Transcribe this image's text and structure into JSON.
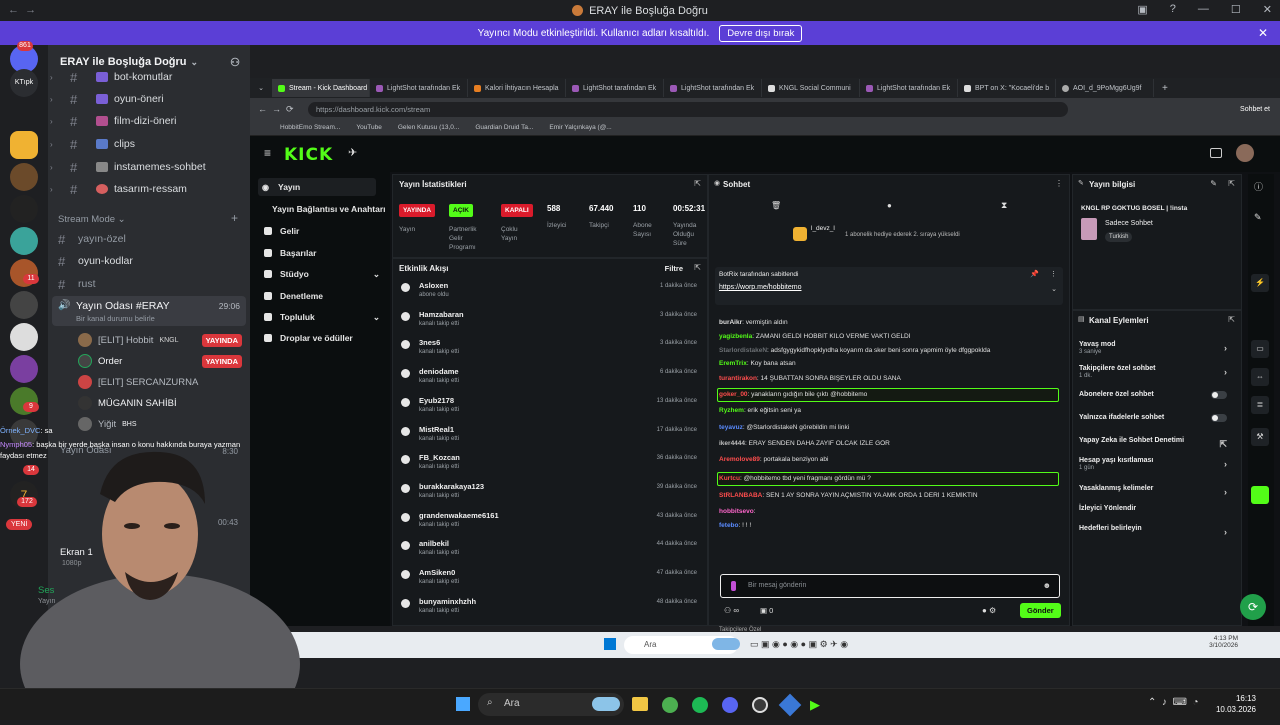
{
  "window": {
    "title": "ERAY ile Boşluğa Doğru"
  },
  "banner": {
    "text": "Yayıncı Modu etkinleştirildi. Kullanıcı adları kısaltıldı.",
    "button": "Devre dışı bırak"
  },
  "rail": {
    "badges": [
      "861",
      "11",
      "9",
      "14",
      "172"
    ],
    "new_label": "YENİ"
  },
  "server": {
    "name": "ERAY ile Boşluğa Doğru",
    "channels": [
      {
        "name": "bot-komutlar"
      },
      {
        "name": "oyun-öneri"
      },
      {
        "name": "film-dizi-öneri"
      },
      {
        "name": "clips"
      },
      {
        "name": "instamemes-sohbet"
      },
      {
        "name": "tasarım-ressam"
      }
    ],
    "category": "Stream Mode",
    "stream_channels": [
      {
        "name": "yayın-özel"
      },
      {
        "name": "oyun-kodlar"
      },
      {
        "name": "rust"
      }
    ],
    "voice": {
      "name": "Yayın Odası #ERAY",
      "time": "29:06",
      "status": "Bir kanal durumu belirle",
      "users": [
        {
          "name": "[ELIT] Hobbit",
          "tag": "KNGL",
          "live": "YAYINDA"
        },
        {
          "name": "Order",
          "live": "YAYINDA"
        },
        {
          "name": "[ELIT] SERCANZURNA"
        },
        {
          "name": "MÜGANIN SAHİBİ"
        },
        {
          "name": "Yiğit",
          "tag": "BHS"
        }
      ]
    },
    "voice2_name": "Yayın Odası",
    "voice2_time": "8:30",
    "voice3_time": "00:43"
  },
  "overlay_chat": [
    {
      "user": "Örnek_DVC",
      "text": ": sa"
    },
    {
      "user": "Nymph05",
      "text": ": başka bir yerde başka insan o konu hakkında buraya yazman"
    },
    {
      "user": "",
      "text": "faydası etmez"
    }
  ],
  "screenshare": {
    "name": "Ekran 1",
    "quality": "1080p",
    "audio": "Ses",
    "audio_sub": "Yayın"
  },
  "browser": {
    "tabs": [
      "Stream - Kick Dashboard",
      "LightShot tarafından Ek",
      "Kalori İhtiyacın Hesapla",
      "LightShot tarafından Ek",
      "LightShot tarafından Ek",
      "KNGL Social Communi",
      "LightShot tarafından Ek",
      "BPT on X: \"Kocaeli'de b",
      "AOI_d_9PoMgg6Ug9f"
    ],
    "url": "https://dashboard.kick.com/stream",
    "bookmarks": [
      "HobbitEmo Stream...",
      "YouTube",
      "Gelen Kutusu (13,0...",
      "Guardian Druid Ta...",
      "Emir Yalçınkaya (@..."
    ]
  },
  "kick": {
    "logo": "KICK",
    "nav": [
      "Yayın",
      "Yayın Bağlantısı ve Anahtarı",
      "Gelir",
      "Başarılar",
      "Stüdyo",
      "Denetleme",
      "Topluluk",
      "Droplar ve ödüller"
    ],
    "stats": {
      "title": "Yayın İstatistikleri",
      "badges": [
        "YAYINDA",
        "AÇIK",
        "KAPALI"
      ],
      "values": [
        "588",
        "67.440",
        "110",
        "00:52:31"
      ],
      "labels": [
        "Yayın",
        "Partnerlik Gelir Programı",
        "Çoklu Yayın",
        "İzleyici",
        "Takipçi",
        "Abone Sayısı",
        "Yayında Olduğu Süre"
      ]
    },
    "activity": {
      "title": "Etkinlik Akışı",
      "filter": "Filtre",
      "items": [
        {
          "name": "Asloxen",
          "sub": "abone oldu",
          "time": "1 dakika önce"
        },
        {
          "name": "Hamzabaran",
          "sub": "kanalı takip etti",
          "time": "3 dakika önce"
        },
        {
          "name": "3nes6",
          "sub": "kanalı takip etti",
          "time": "3 dakika önce"
        },
        {
          "name": "deniodame",
          "sub": "kanalı takip etti",
          "time": "6 dakika önce"
        },
        {
          "name": "Eyub2178",
          "sub": "kanalı takip etti",
          "time": "13 dakika önce"
        },
        {
          "name": "MistReal1",
          "sub": "kanalı takip etti",
          "time": "17 dakika önce"
        },
        {
          "name": "FB_Kozcan",
          "sub": "kanalı takip etti",
          "time": "36 dakika önce"
        },
        {
          "name": "burakkarakaya123",
          "sub": "kanalı takip etti",
          "time": "39 dakika önce"
        },
        {
          "name": "grandenwakaeme6161",
          "sub": "kanalı takip etti",
          "time": "43 dakika önce"
        },
        {
          "name": "anilbekil",
          "sub": "kanalı takip etti",
          "time": "44 dakika önce"
        },
        {
          "name": "AmSiken0",
          "sub": "kanalı takip etti",
          "time": "47 dakika önce"
        },
        {
          "name": "bunyaminxhzhh",
          "sub": "kanalı takip etti",
          "time": "48 dakika önce"
        }
      ]
    },
    "chat": {
      "title": "Sohbet",
      "gift_user": "l_devz_l",
      "gift_text": "1 abonelik hediye ederek 2. sıraya yükseldi",
      "pinned_by": "BotRix tarafından sabitlendi",
      "pinned_link": "https://worp.me/hobbitemo",
      "messages": [
        {
          "user": "burAikr",
          "text": ": vermiştin aldın",
          "color": "#e0e0e0"
        },
        {
          "user": "yagizbenla",
          "text": ": ZAMANI GELDİ HOBBİT KİLO VERME VAKTİ GELDİ",
          "color": "#53fc18"
        },
        {
          "user": "StarlordistakeN",
          "text": ": adsfgygykidfhopklyıdha koyarım da sker beni sonra yapmim öyle dfggpoklda",
          "color": "#6b6f73"
        },
        {
          "user": "EremTrix",
          "text": ": Koy bana atsan",
          "color": "#53fc18"
        },
        {
          "user": "turantirakon",
          "text": ": 14 ŞUBATTAN SONRA BİŞEYLER OLDU SANA",
          "color": "#ff4d4d"
        },
        {
          "user": "goker_00",
          "text": ": yanakların gıdığın bile çıktı @hobbitemo",
          "color": "#ff4d4d"
        },
        {
          "user": "Ryzhem",
          "text": ": erik eğitsin seni ya",
          "color": "#53fc18"
        },
        {
          "user": "teyavuz",
          "text": ": @StarlordistakeN görebildin mi linki",
          "color": "#5a8bff"
        },
        {
          "user": "iker4444",
          "text": ": ERAY SENDEN DAHA ZAYIF OLCAK İZLE GÖR",
          "color": "#c0c0c0"
        },
        {
          "user": "Aremolove89",
          "text": ": portakala benziyon abi",
          "color": "#ff4d4d"
        },
        {
          "user": "Kurtcu",
          "text": ": @hobbitemo tbd yeni fragmanı gördün mü ?",
          "color": "#ff4d4d"
        },
        {
          "user": "StRLANBABA",
          "text": ": SEN 1 AY SONRA YAYIN AÇMISTIN YA AMK ORDA 1 DERİ 1 KEMİKTİN",
          "color": "#ff4d4d"
        },
        {
          "user": "hobbitsevo",
          "text": ":",
          "color": "#ff66cc"
        },
        {
          "user": "fetebo",
          "text": ": ! ! !",
          "color": "#5a8bff"
        }
      ],
      "follower_only": "Takipçilere Özel",
      "input_placeholder": "Bir mesaj gönderin",
      "send": "Gönder",
      "count": "0"
    },
    "info": {
      "title": "Yayın bilgisi",
      "stream_title": "KNGL RP GOKTUG BOSEL | !insta",
      "category": "Sadece Sohbet",
      "language": "Turkish"
    },
    "actions": {
      "title": "Kanal Eylemleri",
      "items": [
        {
          "label": "Yavaş mod",
          "sub": "3 saniye",
          "ctrl": "chev"
        },
        {
          "label": "Takipçilere özel sohbet",
          "sub": "1 dk.",
          "ctrl": "chev"
        },
        {
          "label": "Abonelere özel sohbet",
          "sub": "",
          "ctrl": "toggle"
        },
        {
          "label": "Yalnızca ifadelerle sohbet",
          "sub": "",
          "ctrl": "toggle"
        },
        {
          "label": "Yapay Zeka ile Sohbet Denetimi",
          "sub": "",
          "ctrl": "ext"
        },
        {
          "label": "Hesap yaşı kısıtlaması",
          "sub": "1 gün",
          "ctrl": "chev"
        },
        {
          "label": "Yasaklanmış kelimeler",
          "sub": "",
          "ctrl": "chev"
        },
        {
          "label": "İzleyici Yönlendir",
          "sub": "",
          "ctrl": ""
        },
        {
          "label": "Hedefleri belirleyin",
          "sub": "",
          "ctrl": "chev"
        }
      ]
    }
  },
  "inner_taskbar": {
    "search": "Ara",
    "time": "4:13 PM",
    "date": "3/10/2026"
  },
  "taskbar": {
    "search": "Ara",
    "time": "16:13",
    "date": "10.03.2026"
  }
}
